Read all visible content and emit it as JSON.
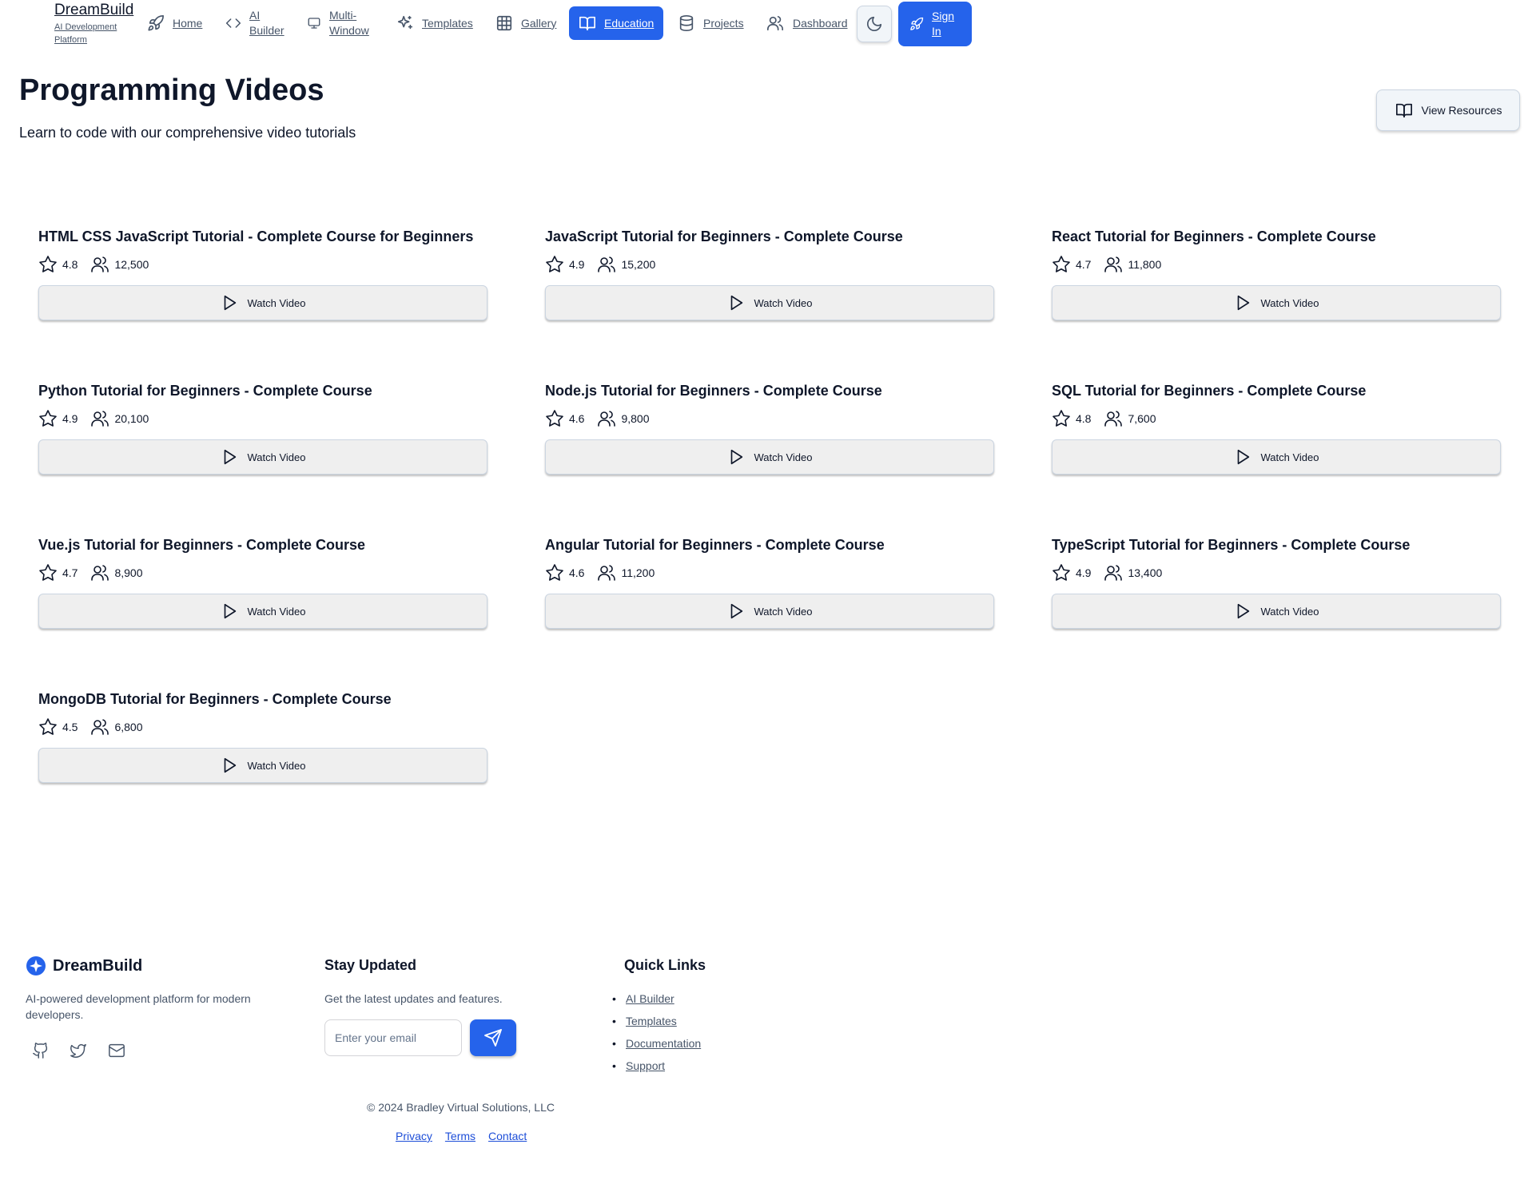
{
  "nav": {
    "brand": "DreamBuild",
    "brand_sub": "AI Development Platform",
    "items": [
      {
        "label": "Home",
        "icon": "rocket-icon"
      },
      {
        "label": "AI Builder",
        "icon": "code-icon"
      },
      {
        "label": "Multi-Window",
        "icon": "monitor-icon"
      },
      {
        "label": "Templates",
        "icon": "sparkles-icon"
      },
      {
        "label": "Gallery",
        "icon": "grid-icon"
      },
      {
        "label": "Education",
        "icon": "book-icon",
        "active": true
      },
      {
        "label": "Projects",
        "icon": "database-icon"
      },
      {
        "label": "Dashboard",
        "icon": "users-icon"
      }
    ],
    "theme_icon": "moon-icon",
    "signin_label": "Sign In"
  },
  "header": {
    "title": "Programming Videos",
    "subtitle": "Learn to code with our comprehensive video tutorials",
    "resources_label": "View Resources"
  },
  "videos": [
    {
      "title": "HTML CSS JavaScript Tutorial - Complete Course for Beginners",
      "rating": "4.8",
      "students": "12,500",
      "button": "Watch Video"
    },
    {
      "title": "JavaScript Tutorial for Beginners - Complete Course",
      "rating": "4.9",
      "students": "15,200",
      "button": "Watch Video"
    },
    {
      "title": "React Tutorial for Beginners - Complete Course",
      "rating": "4.7",
      "students": "11,800",
      "button": "Watch Video"
    },
    {
      "title": "Python Tutorial for Beginners - Complete Course",
      "rating": "4.9",
      "students": "20,100",
      "button": "Watch Video"
    },
    {
      "title": "Node.js Tutorial for Beginners - Complete Course",
      "rating": "4.6",
      "students": "9,800",
      "button": "Watch Video"
    },
    {
      "title": "SQL Tutorial for Beginners - Complete Course",
      "rating": "4.8",
      "students": "7,600",
      "button": "Watch Video"
    },
    {
      "title": "Vue.js Tutorial for Beginners - Complete Course",
      "rating": "4.7",
      "students": "8,900",
      "button": "Watch Video"
    },
    {
      "title": "Angular Tutorial for Beginners - Complete Course",
      "rating": "4.6",
      "students": "11,200",
      "button": "Watch Video"
    },
    {
      "title": "TypeScript Tutorial for Beginners - Complete Course",
      "rating": "4.9",
      "students": "13,400",
      "button": "Watch Video"
    },
    {
      "title": "MongoDB Tutorial for Beginners - Complete Course",
      "rating": "4.5",
      "students": "6,800",
      "button": "Watch Video"
    }
  ],
  "footer": {
    "brand": "DreamBuild",
    "description": "AI-powered development platform for modern developers.",
    "social_icons": [
      "github-icon",
      "twitter-icon",
      "mail-icon"
    ],
    "newsletter_heading": "Stay Updated",
    "newsletter_text": "Get the latest updates and features.",
    "email_placeholder": "Enter your email",
    "quick_links_heading": "Quick Links",
    "quick_links": [
      "AI Builder",
      "Templates",
      "Documentation",
      "Support"
    ],
    "copyright": "© 2024 Bradley Virtual Solutions, LLC",
    "legal_links": [
      "Privacy",
      "Terms",
      "Contact"
    ]
  },
  "colors": {
    "accent": "#2563eb",
    "text": "#0f172a",
    "muted": "#475569"
  }
}
